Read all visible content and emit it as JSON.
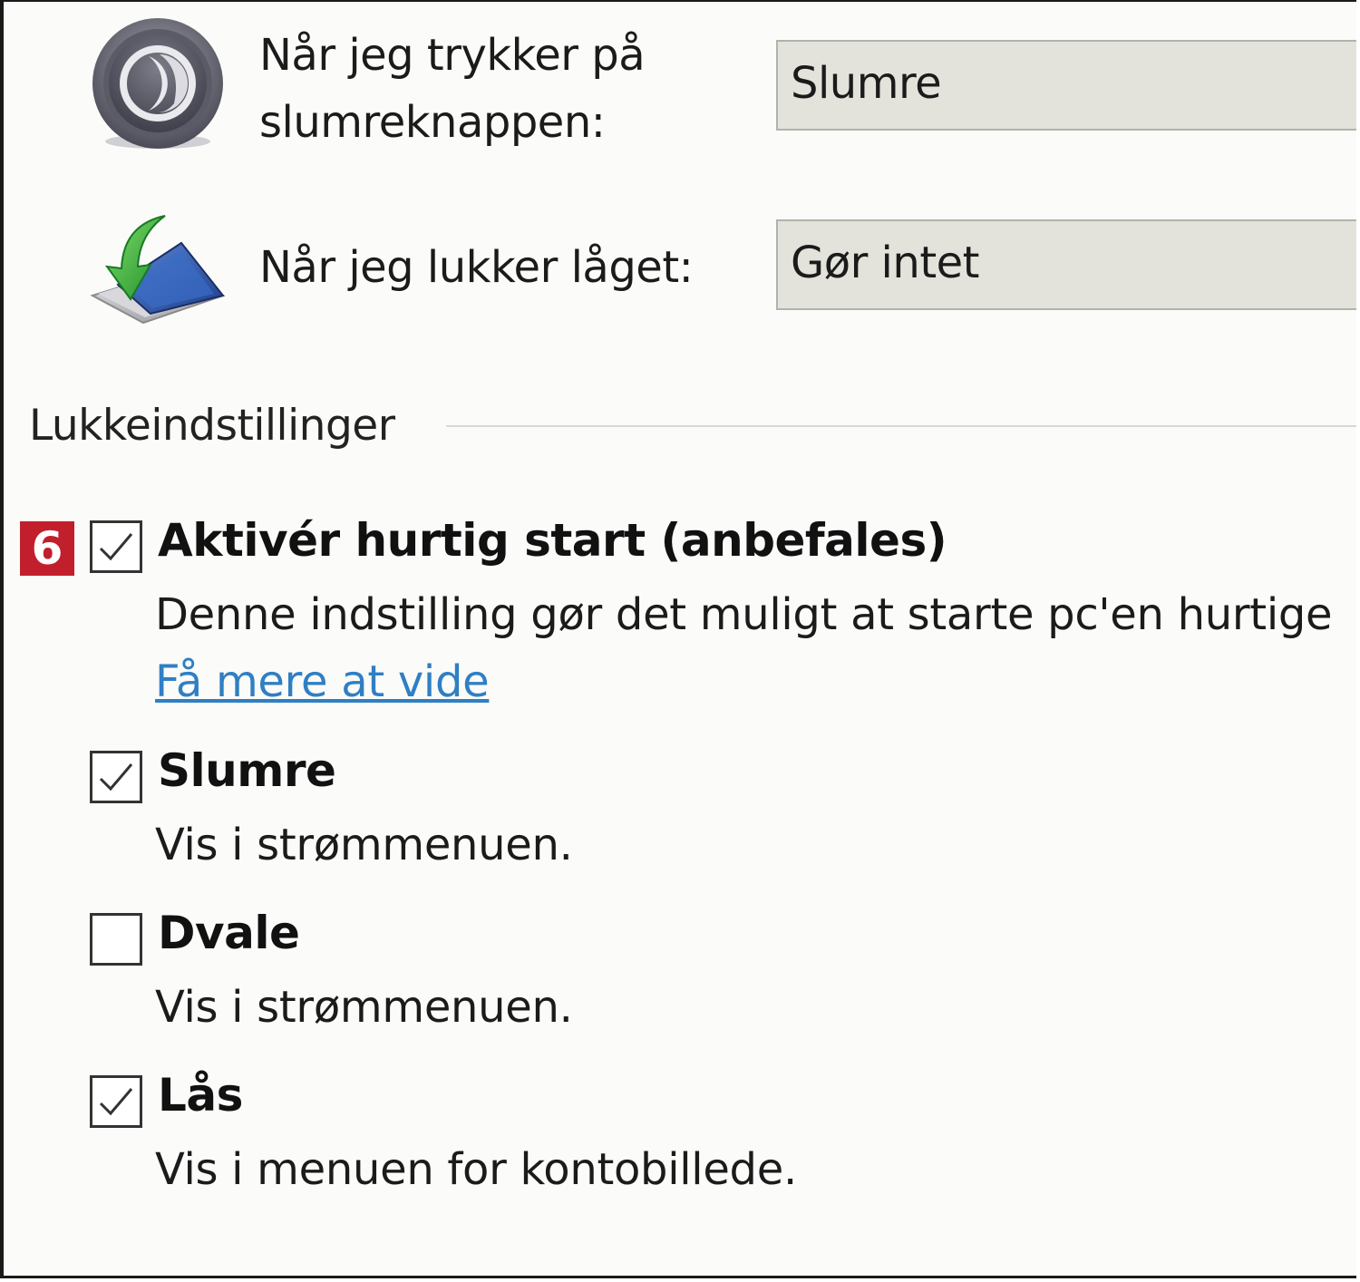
{
  "power_buttons": {
    "sleep_button": {
      "icon": "power-sleep-icon",
      "label_line1": "Når jeg trykker på",
      "label_line2": "slumreknappen:",
      "selected": "Slumre"
    },
    "lid": {
      "icon": "laptop-lid-close-icon",
      "label": "Når jeg lukker låget:",
      "selected": "Gør intet"
    }
  },
  "shutdown_settings": {
    "title": "Lukkeindstillinger",
    "badge": "6",
    "options": [
      {
        "title": "Aktivér hurtig start (anbefales)",
        "description": "Denne indstilling gør det muligt at starte pc'en hurtige",
        "link": "Få mere at vide",
        "checked": true
      },
      {
        "title": "Slumre",
        "description": "Vis i strømmenuen.",
        "checked": true
      },
      {
        "title": "Dvale",
        "description": "Vis i strømmenuen.",
        "checked": false
      },
      {
        "title": "Lås",
        "description": "Vis i menuen for kontobillede.",
        "checked": true
      }
    ]
  },
  "colors": {
    "badge": "#c21f2c",
    "link": "#2f7fc4",
    "dropdown_bg": "#e3e3dc",
    "arrow_green": "#2eaa3a"
  }
}
